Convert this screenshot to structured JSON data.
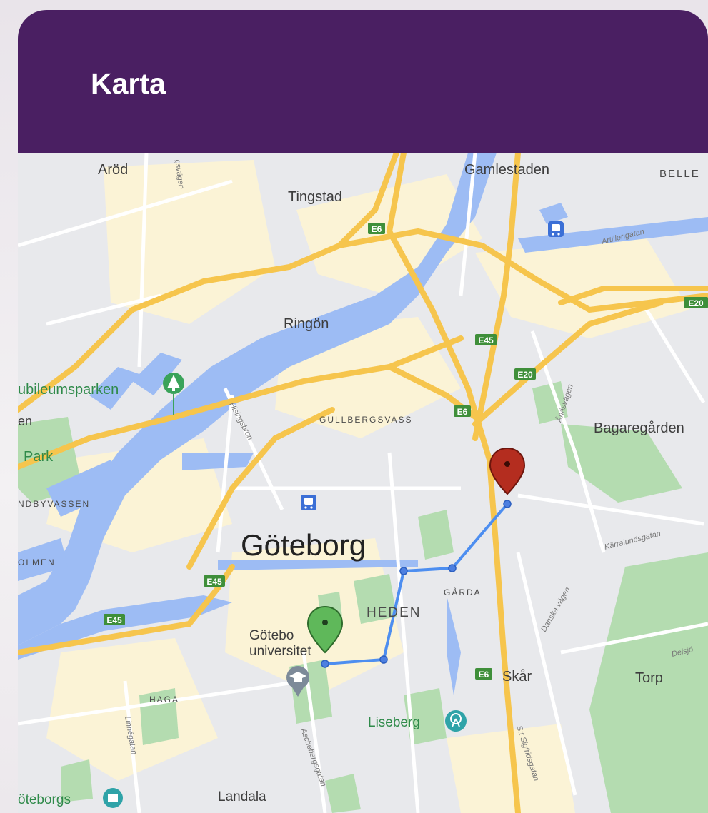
{
  "header": {
    "title": "Karta"
  },
  "map": {
    "labels": {
      "arod": "Aröd",
      "tingstad": "Tingstad",
      "gamlestaden": "Gamlestaden",
      "belle": "BELLE",
      "artillerigatan": "Artillerigatan",
      "ringon": "Ringön",
      "jubileumsparken": "ubileumsparken",
      "en": "en",
      "park": "Park",
      "ndbyvassen": "NDBYVASSEN",
      "gullbergsvass": "GULLBERGSVASS",
      "hisingsbron": "Hisingsbron",
      "anasvagen": "Ånäsvägen",
      "bagaregarden": "Bagaregården",
      "goteborg": "Göteborg",
      "olmen": "OLMEN",
      "karralundsgatan": "Kärralundsgatan",
      "heden": "HEDEN",
      "garda": "GÅRDA",
      "goteborgs_univ_1": "Götebo",
      "goteborgs_univ_2": "universitet",
      "danska_vagen": "Danska vägen",
      "delsjo": "Delsjö",
      "skar": "Skår",
      "torp": "Torp",
      "haga": "HAGA",
      "linnegatan": "Linnégatan",
      "ascheberg": "Aschebergsgatan",
      "liseberg": "Liseberg",
      "sigfridsgatan": "S:t Sigfridsgatan",
      "goteborgs": "öteborgs",
      "landala": "Landala",
      "gullbergs_label": "gsvägen"
    },
    "road_shields": {
      "e6_a": "E6",
      "e6_b": "E6",
      "e6_c": "E6",
      "e45_a": "E45",
      "e45_b": "E45",
      "e45_c": "E45",
      "e20_a": "E20",
      "e20_b": "E20"
    },
    "colors": {
      "land": "#e8e9ec",
      "water": "#9dbcf4",
      "park": "#b4dcb0",
      "urban": "#fbf3d6",
      "highway": "#f6c54d",
      "route": "#4d8ef0",
      "start_pin": "#5fb85a",
      "end_pin": "#b42d1f",
      "header": "#4a1f62"
    },
    "icons": {
      "park_pin": "tree-icon",
      "train_1": "train-icon",
      "train_2": "train-icon",
      "university": "graduation-cap-icon",
      "liseberg": "ferris-wheel-icon",
      "goteborgs_poi": "building-icon"
    }
  }
}
